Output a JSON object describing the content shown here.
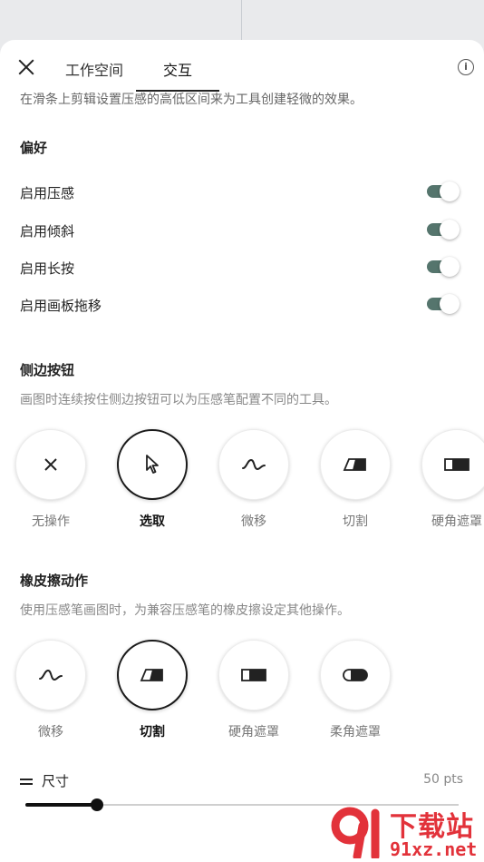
{
  "header": {
    "tabs": [
      {
        "label": "工作空间"
      },
      {
        "label": "交互"
      }
    ],
    "cut_off_text": "在滑条上剪辑设置压感的高低区间来为工具创建轻微的效果。"
  },
  "preferences": {
    "title": "偏好",
    "items": [
      {
        "label": "启用压感",
        "enabled": true
      },
      {
        "label": "启用倾斜",
        "enabled": true
      },
      {
        "label": "启用长按",
        "enabled": true
      },
      {
        "label": "启用画板拖移",
        "enabled": true
      }
    ]
  },
  "side_button": {
    "title": "侧边按钮",
    "description": "画图时连续按住侧边按钮可以为压感笔配置不同的工具。",
    "options": [
      {
        "label": "无操作",
        "icon": "close-icon",
        "selected": false
      },
      {
        "label": "选取",
        "icon": "cursor-icon",
        "selected": true
      },
      {
        "label": "微移",
        "icon": "nudge-wave-icon",
        "selected": false
      },
      {
        "label": "切割",
        "icon": "cut-eraser-icon",
        "selected": false
      },
      {
        "label": "硬角遮罩",
        "icon": "hard-mask-icon",
        "selected": false
      }
    ]
  },
  "eraser_action": {
    "title": "橡皮擦动作",
    "description": "使用压感笔画图时，为兼容压感笔的橡皮擦设定其他操作。",
    "options": [
      {
        "label": "微移",
        "icon": "nudge-wave-icon",
        "selected": false
      },
      {
        "label": "切割",
        "icon": "cut-eraser-icon",
        "selected": true
      },
      {
        "label": "硬角遮罩",
        "icon": "hard-mask-icon",
        "selected": false
      },
      {
        "label": "柔角遮罩",
        "icon": "soft-mask-icon",
        "selected": false
      }
    ]
  },
  "size": {
    "label": "尺寸",
    "value": "50 pts",
    "slider_fraction": 0.165
  },
  "watermark": {
    "title": "下载站",
    "domain": "91xz.net"
  },
  "colors": {
    "toggle_track": "#55756d",
    "watermark_red": "#e2323a"
  }
}
